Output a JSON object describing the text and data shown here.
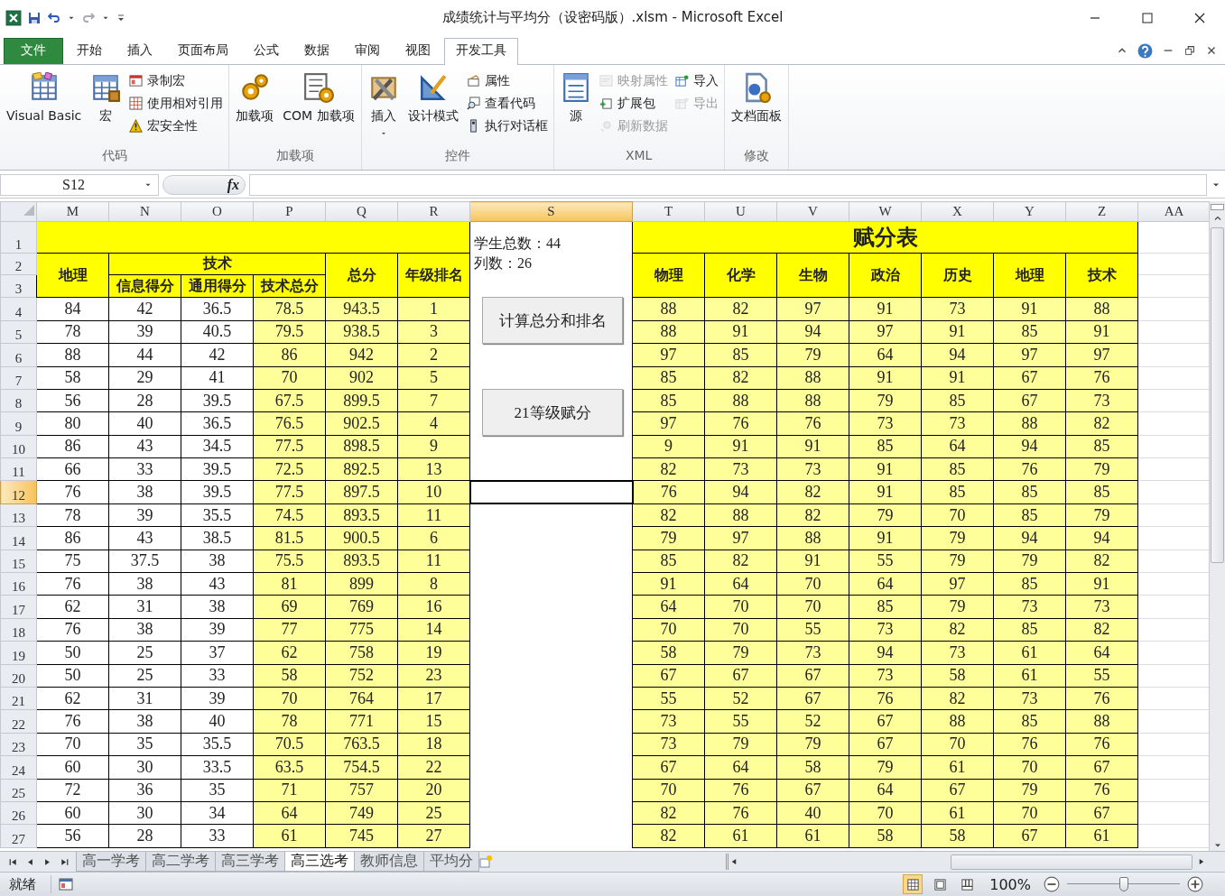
{
  "window": {
    "title": "成绩统计与平均分（设密码版）.xlsm - Microsoft Excel"
  },
  "ribbon_tabs": [
    {
      "label": "文件",
      "kind": "file",
      "selected": false
    },
    {
      "label": "开始",
      "kind": "tab",
      "selected": false
    },
    {
      "label": "插入",
      "kind": "tab",
      "selected": false
    },
    {
      "label": "页面布局",
      "kind": "tab",
      "selected": false
    },
    {
      "label": "公式",
      "kind": "tab",
      "selected": false
    },
    {
      "label": "数据",
      "kind": "tab",
      "selected": false
    },
    {
      "label": "审阅",
      "kind": "tab",
      "selected": false
    },
    {
      "label": "视图",
      "kind": "tab",
      "selected": false
    },
    {
      "label": "开发工具",
      "kind": "tab",
      "selected": true
    }
  ],
  "ribbon_groups": [
    {
      "label": "代码",
      "items": [
        {
          "kind": "large",
          "label": "Visual Basic",
          "disabled": false
        },
        {
          "kind": "large",
          "label": "宏",
          "disabled": false
        },
        {
          "kind": "stack",
          "items": [
            {
              "label": "录制宏",
              "disabled": false
            },
            {
              "label": "使用相对引用",
              "disabled": false
            },
            {
              "label": "宏安全性",
              "disabled": false
            }
          ]
        }
      ]
    },
    {
      "label": "加载项",
      "items": [
        {
          "kind": "large",
          "label": "加载项",
          "disabled": false
        },
        {
          "kind": "large",
          "label": "COM 加载项",
          "disabled": false
        }
      ]
    },
    {
      "label": "控件",
      "items": [
        {
          "kind": "dropdown",
          "label": "插入",
          "disabled": false
        },
        {
          "kind": "large",
          "label": "设计模式",
          "disabled": false
        },
        {
          "kind": "stack",
          "items": [
            {
              "label": "属性",
              "disabled": false
            },
            {
              "label": "查看代码",
              "disabled": false
            },
            {
              "label": "执行对话框",
              "disabled": false
            }
          ]
        }
      ]
    },
    {
      "label": "XML",
      "items": [
        {
          "kind": "large",
          "label": "源",
          "disabled": false
        },
        {
          "kind": "stack",
          "items": [
            {
              "label": "映射属性",
              "disabled": true
            },
            {
              "label": "扩展包",
              "disabled": false
            },
            {
              "label": "刷新数据",
              "disabled": true
            }
          ]
        },
        {
          "kind": "stack",
          "items": [
            {
              "label": "导入",
              "disabled": false
            },
            {
              "label": "导出",
              "disabled": true
            }
          ]
        }
      ]
    },
    {
      "label": "修改",
      "items": [
        {
          "kind": "large",
          "label": "文档面板",
          "disabled": false
        }
      ]
    }
  ],
  "name_box": "S12",
  "formula_bar": {
    "function_label": "fx"
  },
  "sheet": {
    "columns": [
      {
        "label": "M",
        "selected": false
      },
      {
        "label": "N",
        "selected": false
      },
      {
        "label": "O",
        "selected": false
      },
      {
        "label": "P",
        "selected": false
      },
      {
        "label": "Q",
        "selected": false
      },
      {
        "label": "R",
        "selected": false
      },
      {
        "label": "S",
        "selected": true
      },
      {
        "label": "T",
        "selected": false
      },
      {
        "label": "U",
        "selected": false
      },
      {
        "label": "V",
        "selected": false
      },
      {
        "label": "W",
        "selected": false
      },
      {
        "label": "X",
        "selected": false
      },
      {
        "label": "Y",
        "selected": false
      },
      {
        "label": "Z",
        "selected": false
      },
      {
        "label": "AA",
        "selected": false
      }
    ],
    "header_rows": [
      {
        "number": "1",
        "selected": false
      },
      {
        "number": "2",
        "selected": false
      },
      {
        "number": "3",
        "selected": false
      }
    ],
    "left_headers": {
      "geography": "地理",
      "tech": "技术",
      "tech_parts": [
        "信息得分",
        "通用得分",
        "技术总分"
      ],
      "total": "总分",
      "rank": "年级排名"
    },
    "info": [
      "学生总数：44",
      "列数：26"
    ],
    "score_title": "赋分表",
    "score_headers": [
      "物理",
      "化学",
      "生物",
      "政治",
      "历史",
      "地理",
      "技术"
    ],
    "buttons": [
      {
        "label": "计算总分和排名"
      },
      {
        "label": "21等级赋分"
      }
    ],
    "rows": [
      {
        "number": "4",
        "selected": false,
        "values": [
          "84",
          "42",
          "36.5",
          "78.5",
          "943.5",
          "1"
        ],
        "scores": [
          "88",
          "82",
          "97",
          "91",
          "73",
          "91",
          "88"
        ]
      },
      {
        "number": "5",
        "selected": false,
        "values": [
          "78",
          "39",
          "40.5",
          "79.5",
          "938.5",
          "3"
        ],
        "scores": [
          "88",
          "91",
          "94",
          "97",
          "91",
          "85",
          "91"
        ]
      },
      {
        "number": "6",
        "selected": false,
        "values": [
          "88",
          "44",
          "42",
          "86",
          "942",
          "2"
        ],
        "scores": [
          "97",
          "85",
          "79",
          "64",
          "94",
          "97",
          "97"
        ]
      },
      {
        "number": "7",
        "selected": false,
        "values": [
          "58",
          "29",
          "41",
          "70",
          "902",
          "5"
        ],
        "scores": [
          "85",
          "82",
          "88",
          "91",
          "91",
          "67",
          "76"
        ]
      },
      {
        "number": "8",
        "selected": false,
        "values": [
          "56",
          "28",
          "39.5",
          "67.5",
          "899.5",
          "7"
        ],
        "scores": [
          "85",
          "88",
          "88",
          "79",
          "85",
          "67",
          "73"
        ]
      },
      {
        "number": "9",
        "selected": false,
        "values": [
          "80",
          "40",
          "36.5",
          "76.5",
          "902.5",
          "4"
        ],
        "scores": [
          "97",
          "76",
          "76",
          "73",
          "73",
          "88",
          "82"
        ]
      },
      {
        "number": "10",
        "selected": false,
        "values": [
          "86",
          "43",
          "34.5",
          "77.5",
          "898.5",
          "9"
        ],
        "scores": [
          "9",
          "91",
          "91",
          "85",
          "64",
          "94",
          "85"
        ]
      },
      {
        "number": "11",
        "selected": false,
        "values": [
          "66",
          "33",
          "39.5",
          "72.5",
          "892.5",
          "13"
        ],
        "scores": [
          "82",
          "73",
          "73",
          "91",
          "85",
          "76",
          "79"
        ]
      },
      {
        "number": "12",
        "selected": true,
        "values": [
          "76",
          "38",
          "39.5",
          "77.5",
          "897.5",
          "10"
        ],
        "scores": [
          "76",
          "94",
          "82",
          "91",
          "85",
          "85",
          "85"
        ]
      },
      {
        "number": "13",
        "selected": false,
        "values": [
          "78",
          "39",
          "35.5",
          "74.5",
          "893.5",
          "11"
        ],
        "scores": [
          "82",
          "88",
          "82",
          "79",
          "70",
          "85",
          "79"
        ]
      },
      {
        "number": "14",
        "selected": false,
        "values": [
          "86",
          "43",
          "38.5",
          "81.5",
          "900.5",
          "6"
        ],
        "scores": [
          "79",
          "97",
          "88",
          "91",
          "79",
          "94",
          "94"
        ]
      },
      {
        "number": "15",
        "selected": false,
        "values": [
          "75",
          "37.5",
          "38",
          "75.5",
          "893.5",
          "11"
        ],
        "scores": [
          "85",
          "82",
          "91",
          "55",
          "79",
          "79",
          "82"
        ]
      },
      {
        "number": "16",
        "selected": false,
        "values": [
          "76",
          "38",
          "43",
          "81",
          "899",
          "8"
        ],
        "scores": [
          "91",
          "64",
          "70",
          "64",
          "97",
          "85",
          "91"
        ]
      },
      {
        "number": "17",
        "selected": false,
        "values": [
          "62",
          "31",
          "38",
          "69",
          "769",
          "16"
        ],
        "scores": [
          "64",
          "70",
          "70",
          "85",
          "79",
          "73",
          "73"
        ]
      },
      {
        "number": "18",
        "selected": false,
        "values": [
          "76",
          "38",
          "39",
          "77",
          "775",
          "14"
        ],
        "scores": [
          "70",
          "70",
          "55",
          "73",
          "82",
          "85",
          "82"
        ]
      },
      {
        "number": "19",
        "selected": false,
        "values": [
          "50",
          "25",
          "37",
          "62",
          "758",
          "19"
        ],
        "scores": [
          "58",
          "79",
          "73",
          "94",
          "73",
          "61",
          "64"
        ]
      },
      {
        "number": "20",
        "selected": false,
        "values": [
          "50",
          "25",
          "33",
          "58",
          "752",
          "23"
        ],
        "scores": [
          "67",
          "67",
          "67",
          "73",
          "58",
          "61",
          "55"
        ]
      },
      {
        "number": "21",
        "selected": false,
        "values": [
          "62",
          "31",
          "39",
          "70",
          "764",
          "17"
        ],
        "scores": [
          "55",
          "52",
          "67",
          "76",
          "82",
          "73",
          "76"
        ]
      },
      {
        "number": "22",
        "selected": false,
        "values": [
          "76",
          "38",
          "40",
          "78",
          "771",
          "15"
        ],
        "scores": [
          "73",
          "55",
          "52",
          "67",
          "88",
          "85",
          "88"
        ]
      },
      {
        "number": "23",
        "selected": false,
        "values": [
          "70",
          "35",
          "35.5",
          "70.5",
          "763.5",
          "18"
        ],
        "scores": [
          "73",
          "79",
          "79",
          "67",
          "70",
          "76",
          "76"
        ]
      },
      {
        "number": "24",
        "selected": false,
        "values": [
          "60",
          "30",
          "33.5",
          "63.5",
          "754.5",
          "22"
        ],
        "scores": [
          "67",
          "64",
          "58",
          "79",
          "61",
          "70",
          "67"
        ]
      },
      {
        "number": "25",
        "selected": false,
        "values": [
          "72",
          "36",
          "35",
          "71",
          "757",
          "20"
        ],
        "scores": [
          "70",
          "76",
          "67",
          "64",
          "67",
          "79",
          "76"
        ]
      },
      {
        "number": "26",
        "selected": false,
        "values": [
          "60",
          "30",
          "34",
          "64",
          "749",
          "25"
        ],
        "scores": [
          "82",
          "76",
          "40",
          "70",
          "61",
          "70",
          "67"
        ]
      },
      {
        "number": "27",
        "selected": false,
        "values": [
          "56",
          "28",
          "33",
          "61",
          "745",
          "27"
        ],
        "scores": [
          "82",
          "61",
          "61",
          "58",
          "58",
          "67",
          "61"
        ]
      }
    ]
  },
  "sheet_tabs": [
    {
      "label": "高一学考",
      "selected": false
    },
    {
      "label": "高二学考",
      "selected": false
    },
    {
      "label": "高三学考",
      "selected": false
    },
    {
      "label": "高三选考",
      "selected": true
    },
    {
      "label": "教师信息",
      "selected": false
    },
    {
      "label": "平均分",
      "selected": false
    }
  ],
  "status_bar": {
    "text": "就绪",
    "views": [
      {
        "selected": true
      },
      {
        "selected": false
      },
      {
        "selected": false
      }
    ],
    "zoom": "100%",
    "zoom_slider": {
      "level": 0.5
    }
  }
}
